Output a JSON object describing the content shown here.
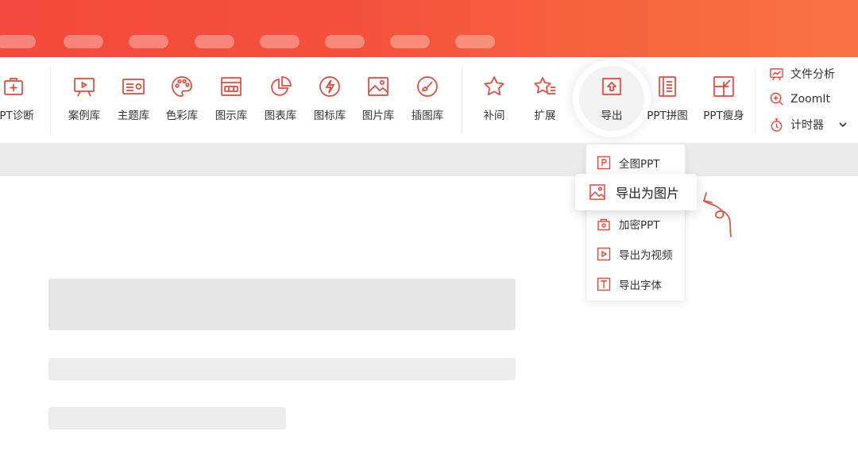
{
  "ribbon": {
    "tools_left": [
      {
        "name": "ppt-diagnose",
        "label": "PPT诊断",
        "icon": "medkit-icon"
      }
    ],
    "tools_library": [
      {
        "name": "case-library",
        "label": "案例库",
        "icon": "presentation-board-icon"
      },
      {
        "name": "theme-library",
        "label": "主题库",
        "icon": "slide-layout-icon"
      },
      {
        "name": "color-library",
        "label": "色彩库",
        "icon": "palette-icon"
      },
      {
        "name": "diagram-library",
        "label": "图示库",
        "icon": "diagram-frame-icon"
      },
      {
        "name": "chart-library",
        "label": "图表库",
        "icon": "pie-chart-icon"
      },
      {
        "name": "icon-library",
        "label": "图标库",
        "icon": "lightning-icon"
      },
      {
        "name": "picture-library",
        "label": "图片库",
        "icon": "image-icon"
      },
      {
        "name": "illustration-library",
        "label": "插图库",
        "icon": "brush-icon"
      }
    ],
    "tools_right": [
      {
        "name": "supplement",
        "label": "补间",
        "icon": "star-icon"
      },
      {
        "name": "extend",
        "label": "扩展",
        "icon": "star-lines-icon"
      },
      {
        "name": "export",
        "label": "导出",
        "icon": "export-icon"
      },
      {
        "name": "ppt-collage",
        "label": "PPT拼图",
        "icon": "document-icon"
      },
      {
        "name": "ppt-slim",
        "label": "PPT瘦身",
        "icon": "shrink-icon"
      }
    ],
    "side": {
      "file_analysis": "文件分析",
      "zoomit": "ZoomIt",
      "timer": "计时器"
    }
  },
  "export_menu": {
    "items": [
      {
        "name": "full-image-ppt",
        "label": "全图PPT",
        "icon": "ppt-file-icon"
      },
      {
        "name": "export-as-image",
        "label": "导出为图片",
        "icon": "image-icon"
      },
      {
        "name": "encrypt-ppt",
        "label": "加密PPT",
        "icon": "lock-icon"
      },
      {
        "name": "export-as-video",
        "label": "导出为视频",
        "icon": "video-icon"
      },
      {
        "name": "export-font",
        "label": "导出字体",
        "icon": "font-icon"
      }
    ]
  },
  "colors": {
    "accent": "#e3473b",
    "titlebar_start": "#f24a3c",
    "titlebar_end": "#f87341"
  }
}
